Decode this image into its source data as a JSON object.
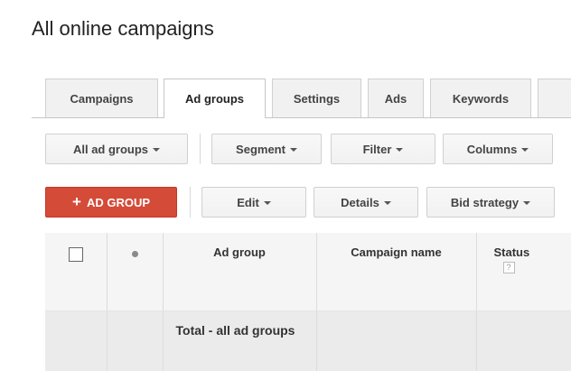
{
  "page": {
    "title": "All online campaigns"
  },
  "tabs": [
    {
      "label": "Campaigns",
      "active": false
    },
    {
      "label": "Ad groups",
      "active": true
    },
    {
      "label": "Settings",
      "active": false
    },
    {
      "label": "Ads",
      "active": false
    },
    {
      "label": "Keywords",
      "active": false
    }
  ],
  "toolbar1": {
    "all_ad_groups": "All ad groups",
    "segment": "Segment",
    "filter": "Filter",
    "columns": "Columns"
  },
  "toolbar2": {
    "add_ad_group": "AD GROUP",
    "add_symbol": "+",
    "edit": "Edit",
    "details": "Details",
    "bid_strategy": "Bid strategy"
  },
  "table": {
    "columns": [
      "Ad group",
      "Campaign name",
      "Status"
    ],
    "status_help": "?",
    "total_row_label": "Total - all ad groups"
  },
  "colors": {
    "accent_red": "#d44b38",
    "header_bg": "#f5f5f5",
    "total_bg": "#ebebeb"
  }
}
